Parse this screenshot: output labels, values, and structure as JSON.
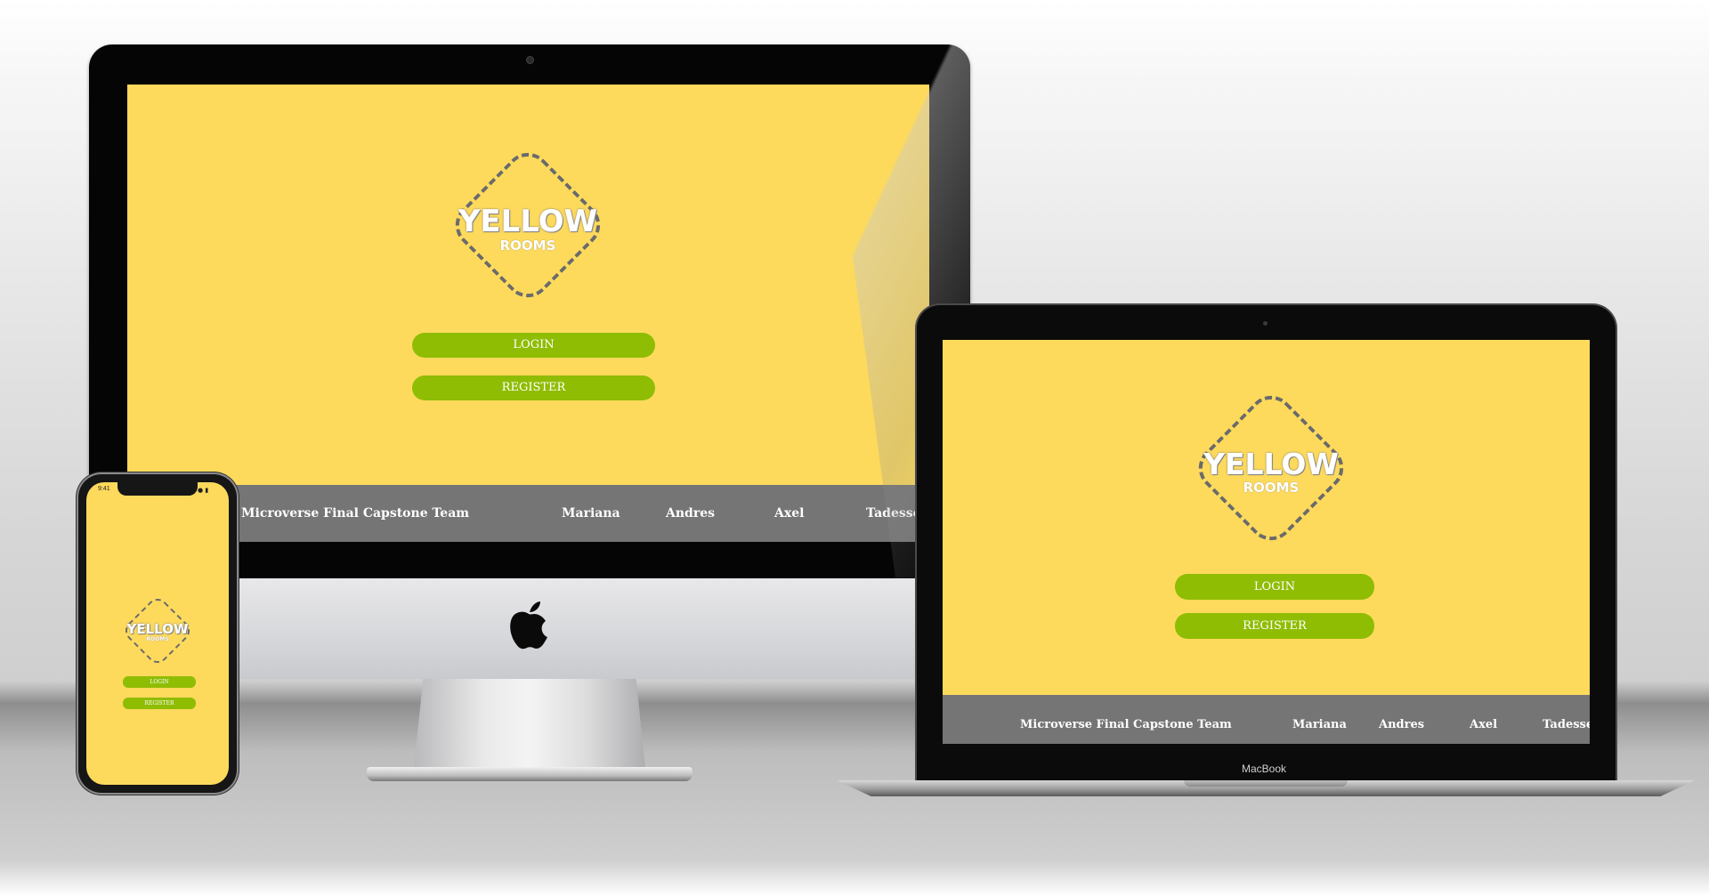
{
  "app": {
    "logo_main": "YELLOW",
    "logo_sub": "ROOMS",
    "login_label": "LOGIN",
    "register_label": "REGISTER"
  },
  "footer": {
    "team": "Microverse Final Capstone Team",
    "members": [
      "Mariana",
      "Andres",
      "Axel",
      "Tadesse"
    ]
  },
  "devices": {
    "macbook_label": "MacBook",
    "phone_time": "9:41"
  },
  "colors": {
    "background_yellow": "#fdda5c",
    "button_green": "#8fbd04",
    "footer_gray": "#757575",
    "logo_dash": "#6b6b6b"
  }
}
